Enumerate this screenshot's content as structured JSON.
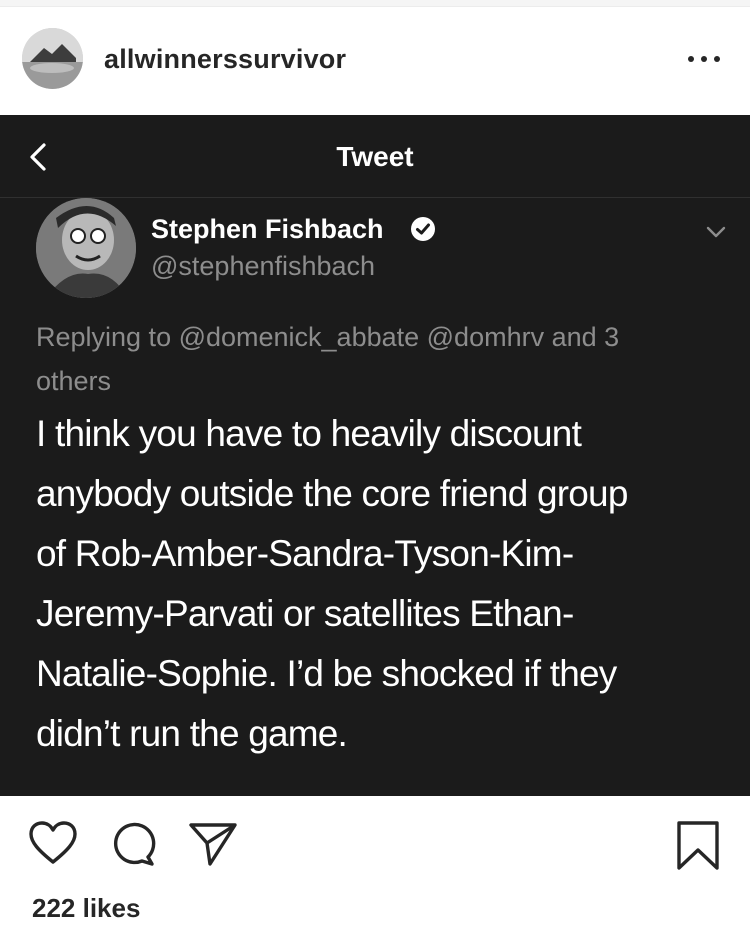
{
  "post": {
    "username": "allwinnerssurvivor",
    "likes_text": "222 likes"
  },
  "tweet": {
    "nav_title": "Tweet",
    "author_name": "Stephen Fishbach",
    "author_handle": "@stephenfishbach",
    "replying_line1": "Replying to @domenick_abbate @domhrv and 3",
    "replying_line2": "others",
    "body_lines": [
      "I think you have to heavily discount",
      "anybody outside the core friend group",
      "of Rob-Amber-Sandra-Tyson-Kim-",
      "Jeremy-Parvati or satellites Ethan-",
      "Natalie-Sophie. I’d be shocked if they",
      "didn’t run the game."
    ]
  },
  "icons": {
    "more": "more-options-icon",
    "back": "chevron-left-icon",
    "verified": "verified-badge-icon",
    "caret": "chevron-down-icon",
    "like": "heart-icon",
    "comment": "comment-bubble-icon",
    "share": "paper-plane-icon",
    "save": "bookmark-icon"
  },
  "colors": {
    "tweet_background": "#1b1b1b",
    "secondary_text": "#8d8d8d",
    "ig_text": "#262626"
  }
}
